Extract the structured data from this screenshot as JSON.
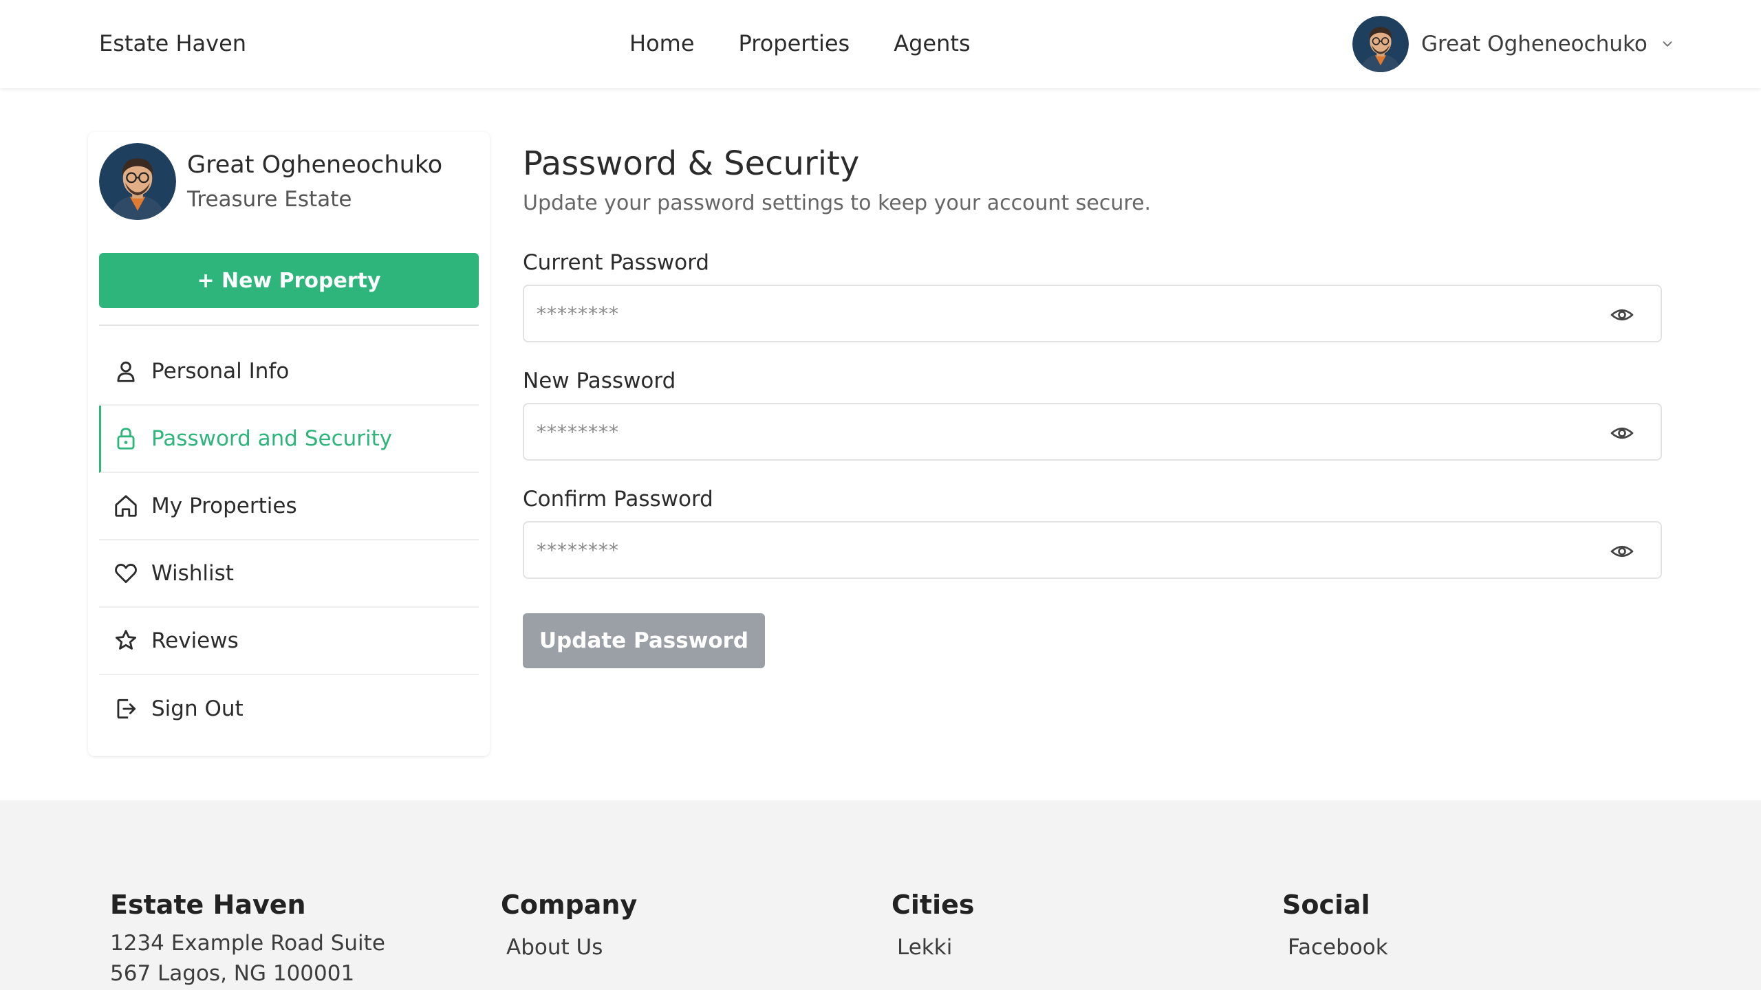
{
  "colors": {
    "accent": "#2db57c",
    "disabled_button": "#9ba0a7",
    "footer_bg": "#f3f3f3",
    "avatar_bg": "#1f3f5f"
  },
  "header": {
    "brand": "Estate Haven",
    "nav": [
      "Home",
      "Properties",
      "Agents"
    ],
    "user_name": "Great Ogheneochuko",
    "avatar_icon": "user-avatar",
    "dropdown_icon": "chevron-down-icon"
  },
  "sidebar": {
    "profile": {
      "name": "Great Ogheneochuko",
      "company": "Treasure Estate"
    },
    "new_property_label": "+ New Property",
    "items": [
      {
        "label": "Personal Info",
        "icon": "user-icon",
        "active": false
      },
      {
        "label": "Password and Security",
        "icon": "lock-icon",
        "active": true
      },
      {
        "label": "My Properties",
        "icon": "home-icon",
        "active": false
      },
      {
        "label": "Wishlist",
        "icon": "heart-icon",
        "active": false
      },
      {
        "label": "Reviews",
        "icon": "star-icon",
        "active": false
      },
      {
        "label": "Sign Out",
        "icon": "sign-out-icon",
        "active": false
      }
    ]
  },
  "main": {
    "title": "Password & Security",
    "subtitle": "Update your password settings to keep your account secure.",
    "fields": [
      {
        "label": "Current Password",
        "value": "",
        "placeholder": "********",
        "icon": "eye-icon"
      },
      {
        "label": "New Password",
        "value": "",
        "placeholder": "********",
        "icon": "eye-icon"
      },
      {
        "label": "Confirm Password",
        "value": "",
        "placeholder": "********",
        "icon": "eye-icon"
      }
    ],
    "submit_label": "Update Password",
    "submit_disabled": true
  },
  "footer": {
    "brand": {
      "title": "Estate Haven",
      "address": "1234 Example Road Suite 567 Lagos, NG 100001"
    },
    "company": {
      "title": "Company",
      "links": [
        "About Us"
      ]
    },
    "cities": {
      "title": "Cities",
      "links": [
        "Lekki"
      ]
    },
    "social": {
      "title": "Social",
      "links": [
        "Facebook"
      ]
    }
  }
}
